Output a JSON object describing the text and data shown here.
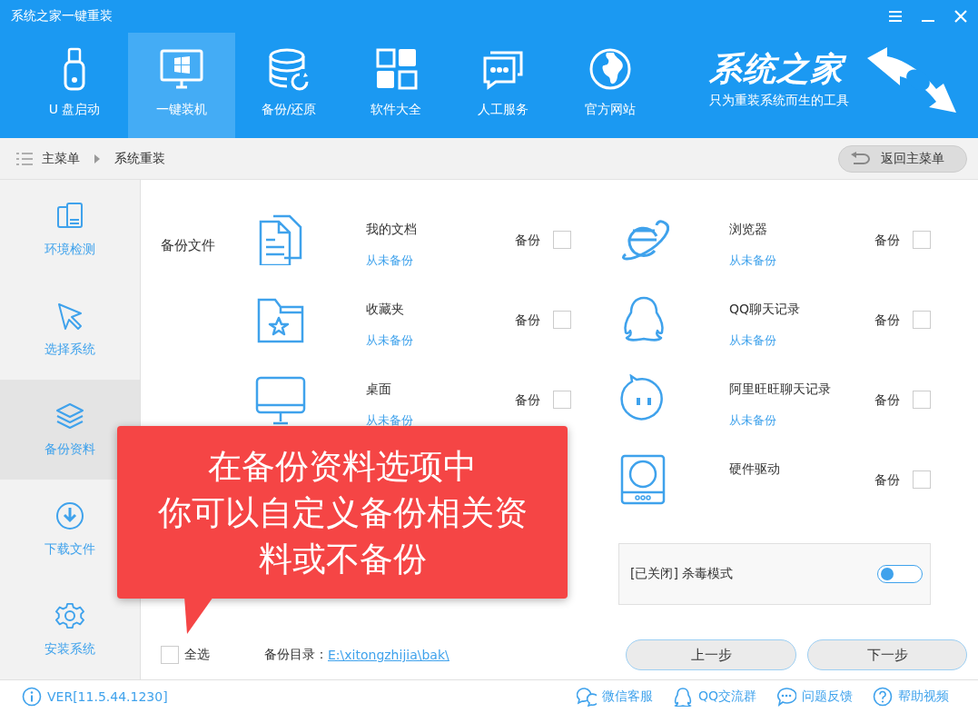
{
  "window": {
    "title": "系统之家一键重装"
  },
  "nav": [
    {
      "label": "U 盘启动",
      "selected": false
    },
    {
      "label": "一键装机",
      "selected": true
    },
    {
      "label": "备份/还原",
      "selected": false
    },
    {
      "label": "软件大全",
      "selected": false
    },
    {
      "label": "人工服务",
      "selected": false
    },
    {
      "label": "官方网站",
      "selected": false
    }
  ],
  "logo": {
    "title": "系统之家",
    "slogan": "只为重装系统而生的工具"
  },
  "breadcrumb": {
    "items": [
      "主菜单",
      "系统重装"
    ],
    "back_button": "返回主菜单"
  },
  "sidebar": [
    {
      "label": "环境检测",
      "selected": false
    },
    {
      "label": "选择系统",
      "selected": false
    },
    {
      "label": "备份资料",
      "selected": true
    },
    {
      "label": "下载文件",
      "selected": false
    },
    {
      "label": "安装系统",
      "selected": false
    }
  ],
  "section_label": "备份文件",
  "left_items": [
    {
      "name": "我的文档",
      "status": "从未备份",
      "backup_label": "备份",
      "checked": false
    },
    {
      "name": "收藏夹",
      "status": "从未备份",
      "backup_label": "备份",
      "checked": false
    },
    {
      "name": "桌面",
      "status": "从未备份",
      "backup_label": "备份",
      "checked": false
    }
  ],
  "right_items": [
    {
      "name": "浏览器",
      "status": "从未备份",
      "backup_label": "备份",
      "checked": false
    },
    {
      "name": "QQ聊天记录",
      "status": "从未备份",
      "backup_label": "备份",
      "checked": false
    },
    {
      "name": "阿里旺旺聊天记录",
      "status": "从未备份",
      "backup_label": "备份",
      "checked": false
    },
    {
      "name": "硬件驱动",
      "backup_label": "备份",
      "checked": false
    }
  ],
  "antivirus": {
    "label": "[已关闭] 杀毒模式",
    "on": false
  },
  "select_all": {
    "label": "全选",
    "checked": false
  },
  "backup_dir": {
    "label": "备份目录：",
    "path": "E:\\xitongzhijia\\bak\\"
  },
  "buttons": [
    "上一步",
    "下一步"
  ],
  "tooltip": {
    "lines": [
      "在备份资料选项中",
      "你可以自定义备份相关资料或不备份"
    ]
  },
  "footer": {
    "version": "VER[11.5.44.1230]",
    "links": [
      "微信客服",
      "QQ交流群",
      "问题反馈",
      "帮助视频"
    ]
  }
}
